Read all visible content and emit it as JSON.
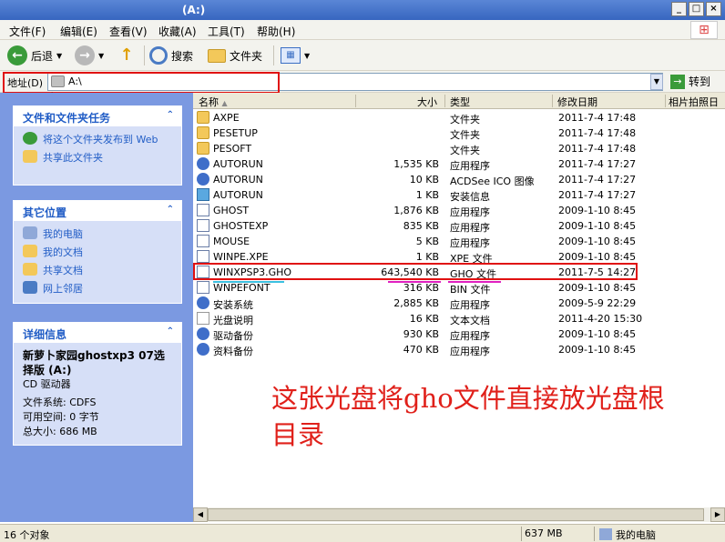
{
  "window": {
    "title": "(A:)"
  },
  "menu": [
    "文件(F)",
    "编辑(E)",
    "查看(V)",
    "收藏(A)",
    "工具(T)",
    "帮助(H)"
  ],
  "toolbar": {
    "back": "后退",
    "search": "搜索",
    "folders": "文件夹"
  },
  "address": {
    "label": "地址(D)",
    "value": "A:\\",
    "go": "转到"
  },
  "tasks_panel": {
    "title": "文件和文件夹任务",
    "items": [
      "将这个文件夹发布到 Web",
      "共享此文件夹"
    ]
  },
  "places_panel": {
    "title": "其它位置",
    "items": [
      "我的电脑",
      "我的文档",
      "共享文档",
      "网上邻居"
    ]
  },
  "details_panel": {
    "title": "详细信息",
    "name": "新萝卜家园ghostxp3 07选择版 (A:)",
    "type": "CD 驱动器",
    "fs": "文件系统: CDFS",
    "free": "可用空间: 0 字节",
    "total": "总大小: 686 MB"
  },
  "columns": [
    "名称",
    "大小",
    "类型",
    "修改日期",
    "相片拍照日"
  ],
  "files": [
    {
      "name": "AXPE",
      "size": "",
      "type": "文件夹",
      "date": "2011-7-4 17:48",
      "icon": "folder-icon"
    },
    {
      "name": "PESETUP",
      "size": "",
      "type": "文件夹",
      "date": "2011-7-4 17:48",
      "icon": "folder-icon"
    },
    {
      "name": "PESOFT",
      "size": "",
      "type": "文件夹",
      "date": "2011-7-4 17:48",
      "icon": "folder-icon"
    },
    {
      "name": "AUTORUN",
      "size": "1,535 KB",
      "type": "应用程序",
      "date": "2011-7-4 17:27",
      "icon": "app-icon"
    },
    {
      "name": "AUTORUN",
      "size": "10 KB",
      "type": "ACDSee ICO 图像",
      "date": "2011-7-4 17:27",
      "icon": "app-icon"
    },
    {
      "name": "AUTORUN",
      "size": "1 KB",
      "type": "安装信息",
      "date": "2011-7-4 17:27",
      "icon": "setup-icon"
    },
    {
      "name": "GHOST",
      "size": "1,876 KB",
      "type": "应用程序",
      "date": "2009-1-10 8:45",
      "icon": "doc-icon"
    },
    {
      "name": "GHOSTEXP",
      "size": "835 KB",
      "type": "应用程序",
      "date": "2009-1-10 8:45",
      "icon": "doc-icon"
    },
    {
      "name": "MOUSE",
      "size": "5 KB",
      "type": "应用程序",
      "date": "2009-1-10 8:45",
      "icon": "doc-icon"
    },
    {
      "name": "WINPE.XPE",
      "size": "1 KB",
      "type": "XPE 文件",
      "date": "2009-1-10 8:45",
      "icon": "doc-icon"
    },
    {
      "name": "WINXPSP3.GHO",
      "size": "643,540 KB",
      "type": "GHO 文件",
      "date": "2011-7-5 14:27",
      "icon": "doc-icon"
    },
    {
      "name": "WNPEFONT",
      "size": "316 KB",
      "type": "BIN 文件",
      "date": "2009-1-10 8:45",
      "icon": "doc-icon"
    },
    {
      "name": "安装系统",
      "size": "2,885 KB",
      "type": "应用程序",
      "date": "2009-5-9 22:29",
      "icon": "app-icon"
    },
    {
      "name": "光盘说明",
      "size": "16 KB",
      "type": "文本文档",
      "date": "2011-4-20 15:30",
      "icon": "text-icon"
    },
    {
      "name": "驱动备份",
      "size": "930 KB",
      "type": "应用程序",
      "date": "2009-1-10 8:45",
      "icon": "app-icon"
    },
    {
      "name": "资料备份",
      "size": "470 KB",
      "type": "应用程序",
      "date": "2009-1-10 8:45",
      "icon": "app-icon"
    }
  ],
  "annotation": "这张光盘将gho文件直接放光盘根目录",
  "status": {
    "count": "16 个对象",
    "size": "637 MB",
    "location": "我的电脑"
  },
  "colors": {
    "accent_red": "#e01010",
    "panel_blue": "#7b99e1"
  }
}
